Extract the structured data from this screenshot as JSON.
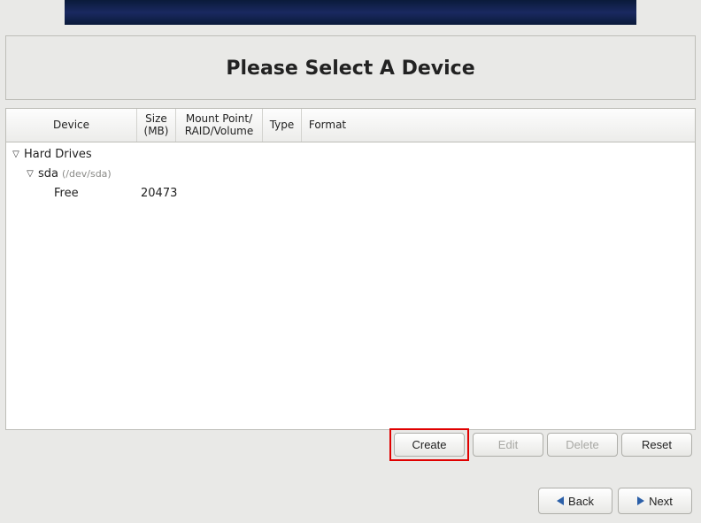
{
  "title": "Please Select A Device",
  "columns": {
    "device": "Device",
    "size": "Size\n(MB)",
    "mount": "Mount Point/\nRAID/Volume",
    "type": "Type",
    "format": "Format"
  },
  "tree": {
    "root_label": "Hard Drives",
    "disk": {
      "name": "sda",
      "path": "(/dev/sda)"
    },
    "free": {
      "label": "Free",
      "size": "20473"
    }
  },
  "buttons": {
    "create": "Create",
    "edit": "Edit",
    "delete": "Delete",
    "reset": "Reset",
    "back": "Back",
    "next": "Next"
  }
}
